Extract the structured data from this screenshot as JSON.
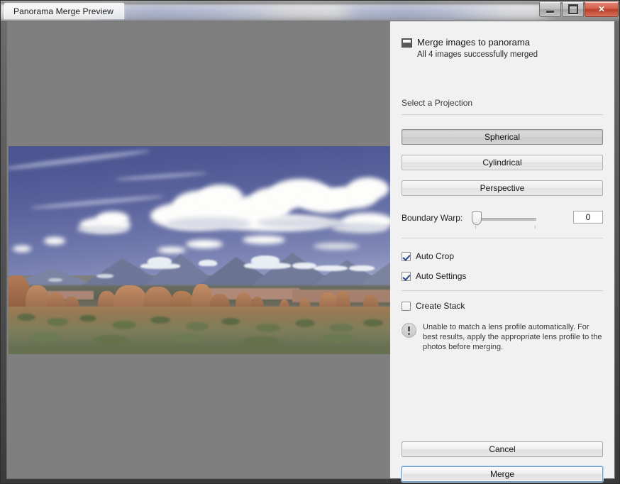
{
  "window": {
    "title": "Panorama Merge Preview",
    "controls": {
      "minimize": "–",
      "maximize": "□",
      "close": "✕"
    }
  },
  "panel": {
    "header": {
      "icon": "picture-icon",
      "title": "Merge images to panorama",
      "subtitle": "All 4 images successfully merged"
    },
    "projection": {
      "label": "Select a Projection",
      "options": [
        {
          "label": "Spherical",
          "selected": true
        },
        {
          "label": "Cylindrical",
          "selected": false
        },
        {
          "label": "Perspective",
          "selected": false
        }
      ]
    },
    "boundary_warp": {
      "label": "Boundary Warp:",
      "value": "0",
      "min": 0,
      "max": 100
    },
    "checkboxes": [
      {
        "label": "Auto Crop",
        "checked": true
      },
      {
        "label": "Auto Settings",
        "checked": true
      },
      {
        "label": "Create Stack",
        "checked": false
      }
    ],
    "warning": {
      "icon": "exclamation-icon",
      "text": "Unable to match a lens profile automatically. For best results, apply the appropriate lens profile to the photos before merging."
    },
    "actions": {
      "cancel": "Cancel",
      "merge": "Merge"
    }
  },
  "preview": {
    "alt": "Panorama preview of desert rock formations with snow-capped mountains",
    "background_color": "#7f7f7f"
  },
  "colors": {
    "panel_bg": "#f1f1f1",
    "preview_bg": "#7f7f7f",
    "accent": "#6aa0d8",
    "check": "#2a4a8c",
    "close_button": "#bb3e28"
  }
}
